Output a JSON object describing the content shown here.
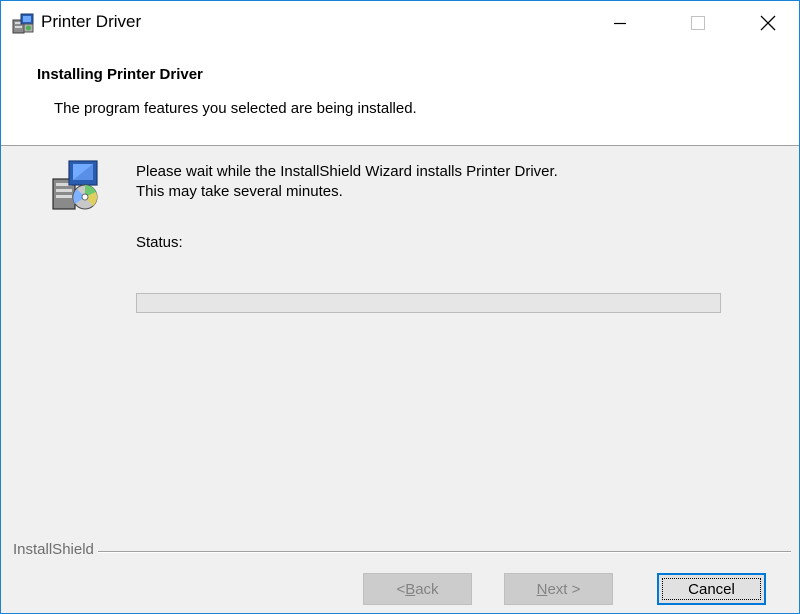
{
  "window": {
    "title": "Printer Driver",
    "accent_color": "#1883d7",
    "icon": "printer-setup-icon"
  },
  "header": {
    "title": "Installing Printer Driver",
    "subtitle": "The program features you selected are being installed."
  },
  "body": {
    "icon": "installer-disc-icon",
    "message_line1": "Please wait while the InstallShield Wizard installs Printer Driver.",
    "message_line2": "This may take several minutes.",
    "status_label": "Status:",
    "status_value": "",
    "progress": 0
  },
  "footer": {
    "brand": "InstallShield",
    "back": {
      "prefix": "< ",
      "mnemonic": "B",
      "rest": "ack",
      "enabled": false
    },
    "next": {
      "mnemonic": "N",
      "rest": "ext >",
      "enabled": false
    },
    "cancel": {
      "label": "Cancel",
      "enabled": true
    }
  }
}
